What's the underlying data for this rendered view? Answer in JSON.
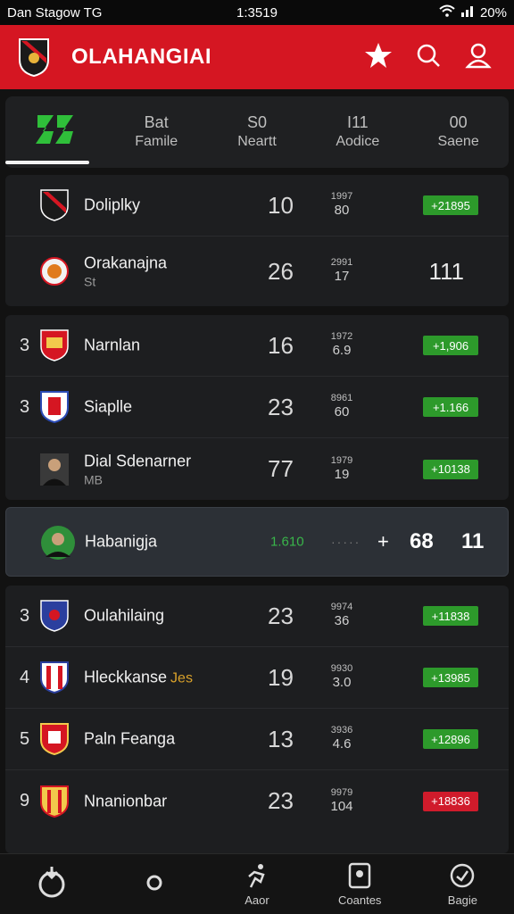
{
  "status": {
    "carrier": "Dan Stagow TG",
    "time": "1:3519",
    "battery": "20%"
  },
  "app": {
    "title": "OLAHANGIAI",
    "accent": "#d51622"
  },
  "tabs": [
    {
      "icon": "brand-logo-icon",
      "num": "",
      "label": ""
    },
    {
      "num": "Bat",
      "label": "Famile"
    },
    {
      "num": "S0",
      "label": "Neartt"
    },
    {
      "num": "I11",
      "label": "Aodice"
    },
    {
      "num": "00",
      "label": "Saene"
    }
  ],
  "group1": [
    {
      "rank": "",
      "team": "Doliplky",
      "sub": "",
      "pts": "10",
      "s1": "1997",
      "s2": "80",
      "badge": "+21895",
      "badge_color": "green"
    },
    {
      "rank": "",
      "team": "Orakanajna",
      "sub": "St",
      "pts": "26",
      "s1": "2991",
      "s2": "17",
      "bigval": "111"
    }
  ],
  "group2": [
    {
      "rank": "3",
      "team": "Narnlan",
      "sub": "",
      "pts": "16",
      "s1": "1972",
      "s2": "6.9",
      "badge": "+1,906",
      "badge_color": "green"
    },
    {
      "rank": "3",
      "team": "Siaplle",
      "sub": "",
      "pts": "23",
      "s1": "8961",
      "s2": "60",
      "badge": "+1.166",
      "badge_color": "green"
    },
    {
      "rank": "",
      "team": "Dial Sdenarner",
      "sub": "MB",
      "pts": "77",
      "s1": "1979",
      "s2": "19",
      "badge": "+10138",
      "badge_color": "green"
    }
  ],
  "highlight": {
    "team": "Habanigja",
    "num": "1.610",
    "dots": "·····",
    "plus": "+",
    "v1": "68",
    "v2": "11"
  },
  "group3": [
    {
      "rank": "3",
      "team": "Oulahilaing",
      "sub": "",
      "pts": "23",
      "s1": "9974",
      "s2": "36",
      "badge": "+11838",
      "badge_color": "green"
    },
    {
      "rank": "4",
      "team": "Hleckkanse",
      "tag": "Jes",
      "sub": "",
      "pts": "19",
      "s1": "9930",
      "s2": "3.0",
      "badge": "+13985",
      "badge_color": "green"
    },
    {
      "rank": "5",
      "team": "Paln Feanga",
      "sub": "",
      "pts": "13",
      "s1": "3936",
      "s2": "4.6",
      "badge": "+12896",
      "badge_color": "green"
    },
    {
      "rank": "9",
      "team": "Nnanionbar",
      "sub": "",
      "pts": "23",
      "s1": "9979",
      "s2": "104",
      "badge": "+18836",
      "badge_color": "red"
    }
  ],
  "nav": [
    {
      "icon": "refresh-icon",
      "label": ""
    },
    {
      "icon": "circle-icon",
      "label": ""
    },
    {
      "icon": "run-icon",
      "label": "Aaor"
    },
    {
      "icon": "card-icon",
      "label": "Coantes"
    },
    {
      "icon": "whistle-icon",
      "label": "Bagie"
    }
  ]
}
